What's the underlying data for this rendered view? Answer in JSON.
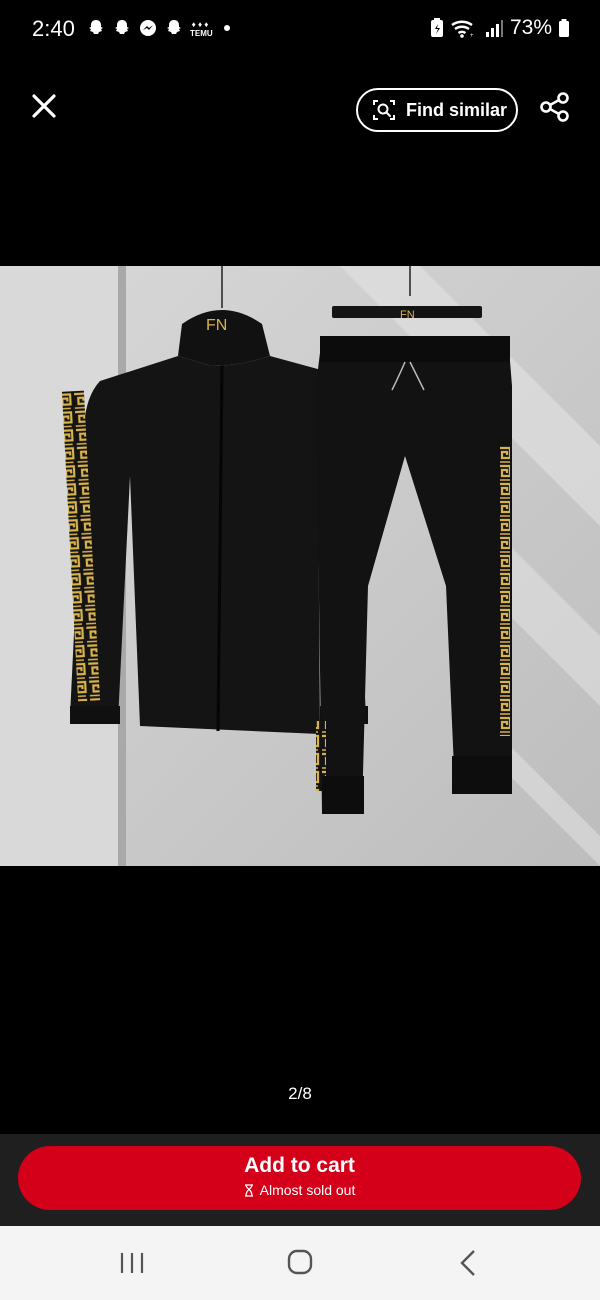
{
  "status_bar": {
    "time": "2:40",
    "notification_icons": [
      "snapchat-icon",
      "snapchat-icon",
      "messenger-icon",
      "snapchat-icon",
      "temu-icon"
    ],
    "temu_label": "TEMU",
    "battery_percent": "73%"
  },
  "toolbar": {
    "find_similar_label": "Find similar"
  },
  "product": {
    "logo_text": "FN",
    "colors": {
      "garment": "#141414",
      "trim": "#d8b24a",
      "wall": "#c9c9c9"
    }
  },
  "pager": {
    "text": "2/8"
  },
  "cart": {
    "button_label": "Add to cart",
    "stock_note": "Almost sold out",
    "accent_color": "#d4001a"
  },
  "nav": {
    "items": [
      "recents-icon",
      "home-icon",
      "back-icon"
    ]
  }
}
